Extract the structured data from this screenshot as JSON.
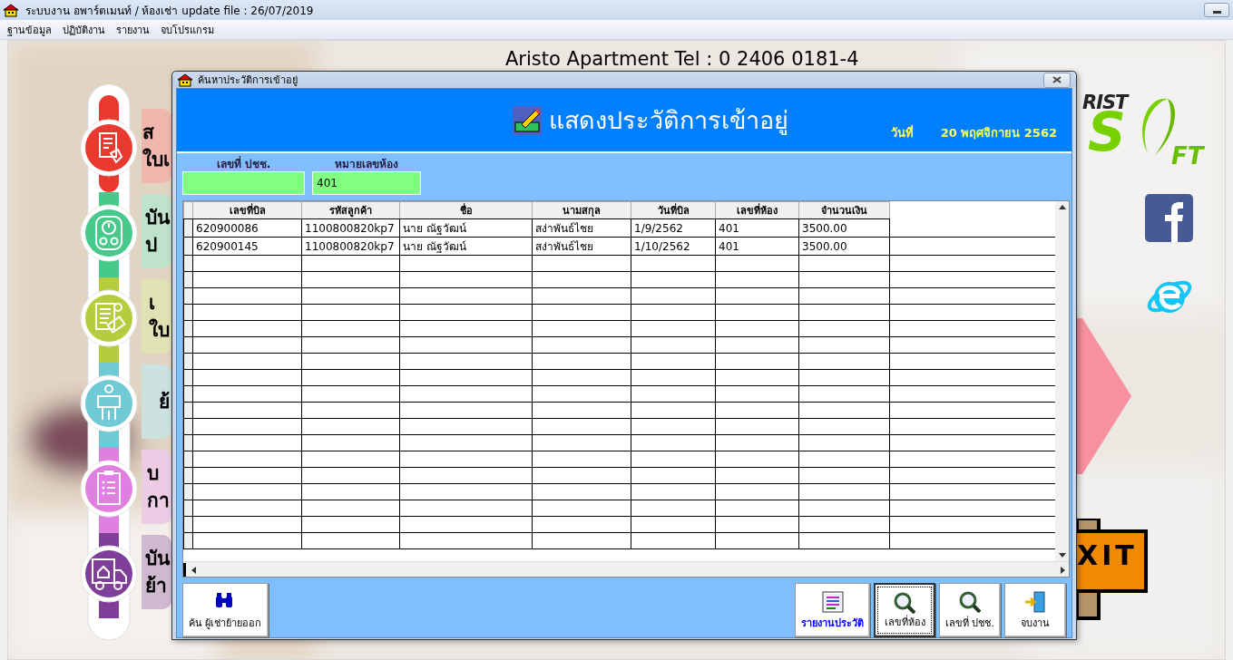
{
  "window": {
    "title": "ระบบงาน อพาร์ตเมนท์ / ห้องเช่า update file : 26/07/2019",
    "menu": [
      "ฐานข้อมูล",
      "ปฏิบัติงาน",
      "รายงาน",
      "จบโปรแกรม"
    ]
  },
  "background": {
    "banner": "Aristo Apartment  Tel : 0 2406 0181-4",
    "logo": [
      "RIST",
      "S",
      "FT"
    ],
    "exit_sign": "XIT",
    "side_menu": [
      {
        "color": "#ea3a30",
        "lines": [
          "ส",
          "ใบเ"
        ]
      },
      {
        "color": "#48c98c",
        "lines": [
          "บัน",
          "ป"
        ]
      },
      {
        "color": "#b6cc3c",
        "lines": [
          "เ",
          "ใบ"
        ]
      },
      {
        "color": "#6fcad6",
        "lines": [
          "ย้"
        ]
      },
      {
        "color": "#df80e0",
        "lines": [
          "บ",
          "กา"
        ]
      },
      {
        "color": "#7f3f99",
        "lines": [
          "บัน",
          "ย้า"
        ]
      }
    ]
  },
  "dialog": {
    "title": "ค้นหาประวัติการเข้าอยู่",
    "heading": "แสดงประวัติการเข้าอยู่",
    "date_label": "วันที่",
    "date": "20 พฤศจิกายน 2562",
    "fields": [
      {
        "label": "เลขที่ ปชช."
      },
      {
        "label": "หมายเลขห้อง",
        "value": "401"
      }
    ],
    "table": {
      "columns": [
        "เลขที่บิล",
        "รหัสลูกค้า",
        "ชื่อ",
        "นามสกุล",
        "วันที่บิล",
        "เลขที่ห้อง",
        "จำนวนเงิน"
      ],
      "rows": [
        [
          "620900086",
          "1100800820kp7",
          "นาย ณัฐวัฒน์",
          "สง่าพันธ์ไชย",
          "1/9/2562",
          "401",
          "3500.00"
        ],
        [
          "620900145",
          "1100800820kp7",
          "นาย ณัฐวัฒน์",
          "สง่าพันธ์ไชย",
          "1/10/2562",
          "401",
          "3500.00"
        ]
      ]
    },
    "buttons": [
      {
        "kind": "binoculars",
        "label": "ค้น ผู้เช่าย้ายออก",
        "focused": false
      },
      {
        "kind": "report",
        "label": "รายงานประวัติ",
        "focused": false
      },
      {
        "kind": "magnifier",
        "label": "เลขที่ห้อง",
        "focused": true
      },
      {
        "kind": "magnifier",
        "label": "เลขที่ ปชช.",
        "focused": false
      },
      {
        "kind": "exit",
        "label": "จบงาน",
        "focused": false
      }
    ]
  }
}
